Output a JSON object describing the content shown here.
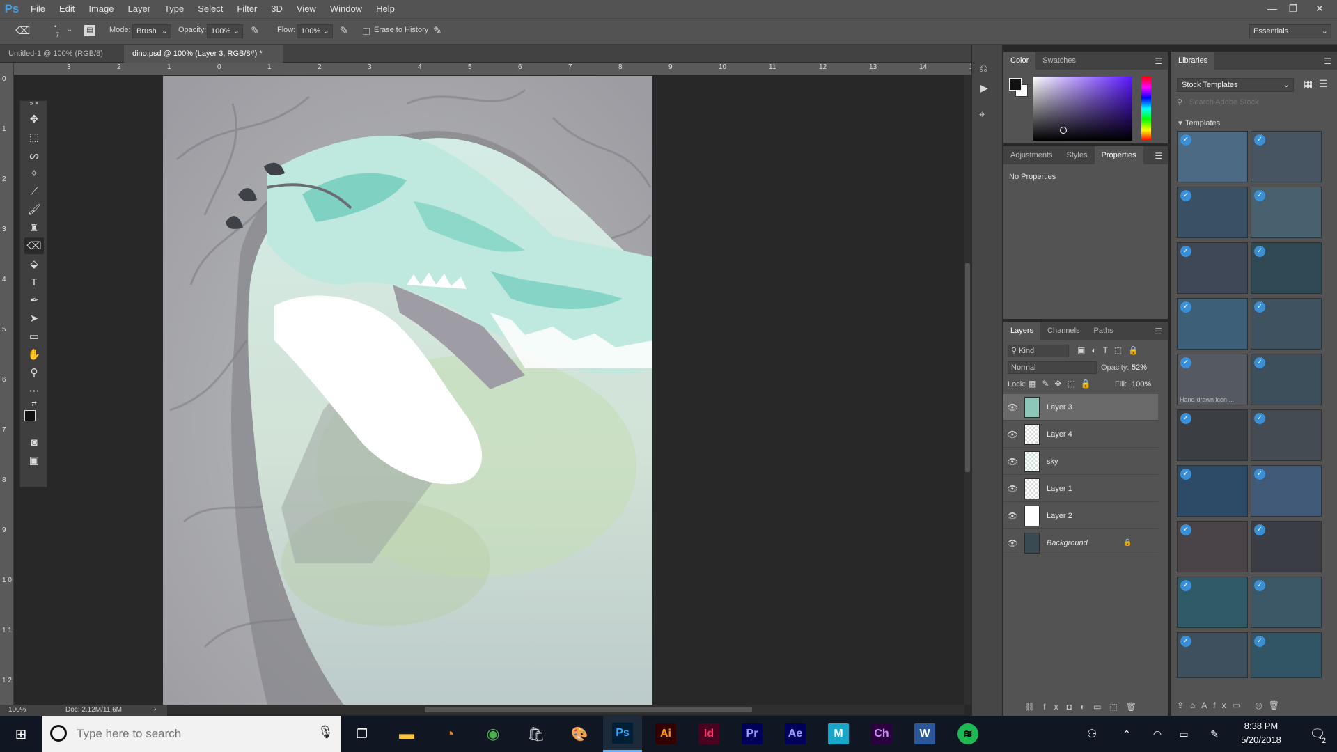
{
  "app": {
    "logo": "Ps"
  },
  "menu": [
    "File",
    "Edit",
    "Image",
    "Layer",
    "Type",
    "Select",
    "Filter",
    "3D",
    "View",
    "Window",
    "Help"
  ],
  "window_controls": {
    "minimize": "—",
    "restore": "❐",
    "close": "✕"
  },
  "options": {
    "brush_size": "7",
    "mode_label": "Mode:",
    "mode_value": "Brush",
    "opacity_label": "Opacity:",
    "opacity_value": "100%",
    "flow_label": "Flow:",
    "flow_value": "100%",
    "erase_history": "Erase to History",
    "workspace": "Essentials"
  },
  "tabs": [
    {
      "label": "Untitled-1 @ 100% (RGB/8)",
      "close": "×"
    },
    {
      "label": "dino.psd @ 100% (Layer 3, RGB/8#) *",
      "close": "×"
    }
  ],
  "ruler_top": [
    "3",
    "2",
    "1",
    "0",
    "1",
    "2",
    "3",
    "4",
    "5",
    "6",
    "7",
    "8",
    "9",
    "10",
    "11",
    "12",
    "13",
    "14",
    "15"
  ],
  "ruler_left": [
    "0",
    "1",
    "2",
    "3",
    "4",
    "5",
    "6",
    "7",
    "8",
    "9",
    "1 0",
    "1 1",
    "1 2"
  ],
  "status": {
    "zoom": "100%",
    "doc": "Doc: 2.12M/11.6M",
    "arrow": "›"
  },
  "color_panel": {
    "tabs": [
      "Color",
      "Swatches"
    ]
  },
  "props_panel": {
    "tabs": [
      "Adjustments",
      "Styles",
      "Properties"
    ],
    "message": "No Properties"
  },
  "layers_panel": {
    "tabs": [
      "Layers",
      "Channels",
      "Paths"
    ],
    "filter": "Kind",
    "blend_mode": "Normal",
    "opacity_label": "Opacity:",
    "opacity_value": "52%",
    "lock_label": "Lock:",
    "fill_label": "Fill:",
    "fill_value": "100%",
    "layers": [
      "Layer 3",
      "Layer 4",
      "sky",
      "Layer 1",
      "Layer 2",
      "Background"
    ]
  },
  "libraries": {
    "title": "Libraries",
    "dropdown": "Stock Templates",
    "search_placeholder": "Search Adobe Stock",
    "section": "Templates",
    "tile_caption": "Hand-drawn icon ..."
  },
  "taskbar": {
    "search_placeholder": "Type here to search",
    "apps": [
      "Ai",
      "Id",
      "Pr",
      "Ae",
      "Ch",
      "W"
    ],
    "time": "8:38 PM",
    "date": "5/20/2018",
    "notif_count": "2"
  }
}
